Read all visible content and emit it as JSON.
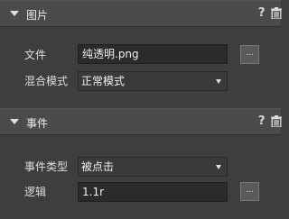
{
  "image_panel": {
    "title": "图片",
    "help": "?",
    "file_label": "文件",
    "file_value": "纯透明.png",
    "browse_label": "...",
    "blend_label": "混合模式",
    "blend_value": "正常模式"
  },
  "event_panel": {
    "title": "事件",
    "help": "?",
    "event_type_label": "事件类型",
    "event_type_value": "被点击",
    "logic_label": "逻辑",
    "logic_value": "1.1r",
    "browse_label": "..."
  }
}
